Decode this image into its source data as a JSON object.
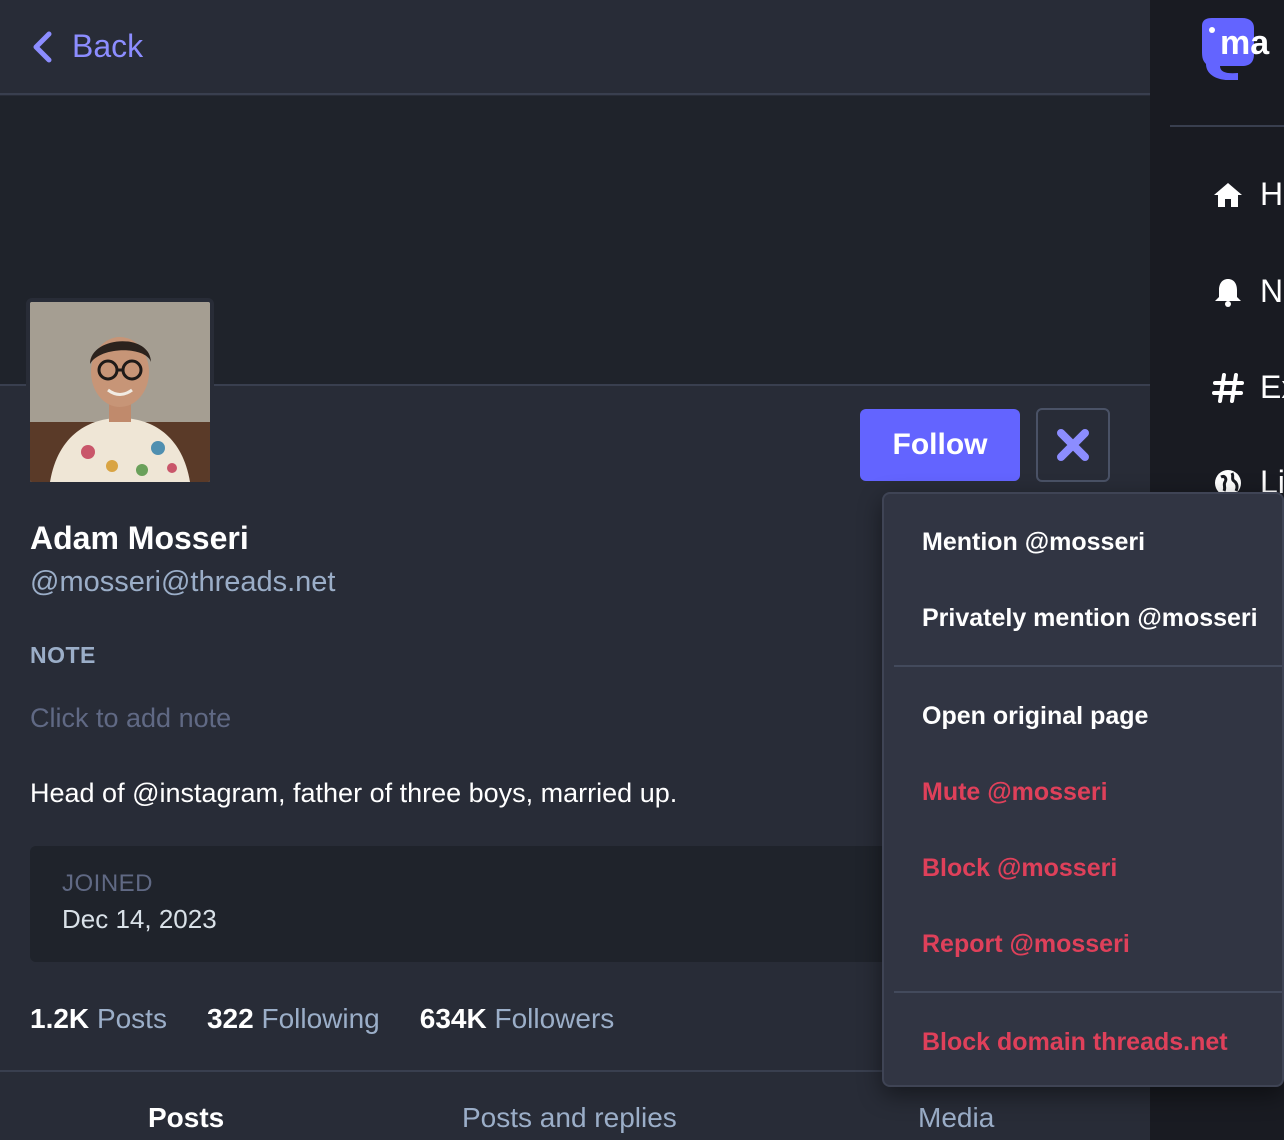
{
  "colors": {
    "accent": "#6364ff",
    "link": "#8c8dff",
    "danger": "#df405a",
    "background": "#282c37",
    "muted_text": "#9baec8"
  },
  "topbar": {
    "back_label": "Back",
    "back_icon": "chevron-left-icon"
  },
  "profile": {
    "display_name": "Adam Mosseri",
    "handle": "@mosseri@threads.net",
    "note_label": "NOTE",
    "note_placeholder": "Click to add note",
    "bio": "Head of @instagram, father of three boys, married up.",
    "joined_label": "JOINED",
    "joined_date": "Dec 14, 2023",
    "stats": [
      {
        "value": "1.2K",
        "label": "Posts"
      },
      {
        "value": "322",
        "label": "Following"
      },
      {
        "value": "634K",
        "label": "Followers"
      }
    ]
  },
  "actions": {
    "follow_label": "Follow",
    "close_icon": "close-icon"
  },
  "tabs": [
    {
      "label": "Posts",
      "active": true
    },
    {
      "label": "Posts and replies",
      "active": false
    },
    {
      "label": "Media",
      "active": false
    }
  ],
  "nav": {
    "logo_text": "ma",
    "items": [
      {
        "label": "Ho",
        "icon": "home-icon"
      },
      {
        "label": "No",
        "icon": "bell-icon"
      },
      {
        "label": "Ex",
        "icon": "hashtag-icon"
      },
      {
        "label": "Li",
        "icon": "globe-icon"
      }
    ]
  },
  "dropdown": {
    "items": [
      {
        "label": "Mention @mosseri",
        "danger": false
      },
      {
        "label": "Privately mention @mosseri",
        "danger": false
      },
      {
        "label": "Open original page",
        "danger": false
      },
      {
        "label": "Mute @mosseri",
        "danger": true
      },
      {
        "label": "Block @mosseri",
        "danger": true
      },
      {
        "label": "Report @mosseri",
        "danger": true
      },
      {
        "label": "Block domain threads.net",
        "danger": true
      }
    ]
  }
}
